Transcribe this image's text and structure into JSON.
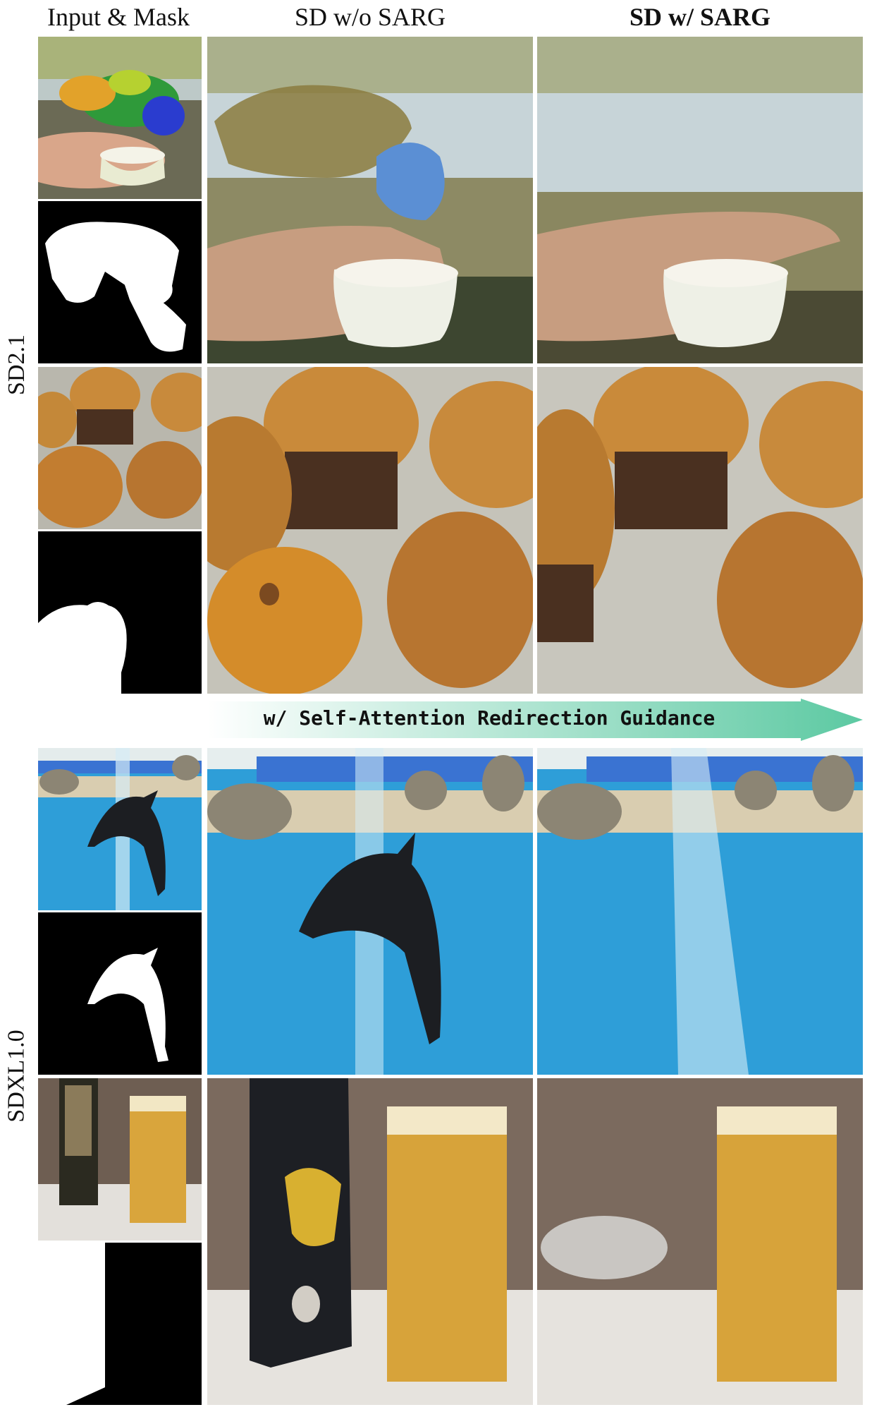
{
  "columns": {
    "input_mask": "Input & Mask",
    "without": "SD w/o SARG",
    "with": "SD w/ SARG"
  },
  "rows": {
    "sd21": "SD2.1",
    "sdxl": "SDXL1.0"
  },
  "banner": {
    "text": "w/ Self-Attention Redirection Guidance",
    "colors": [
      "#ffffff",
      "#5cc9a2"
    ]
  }
}
